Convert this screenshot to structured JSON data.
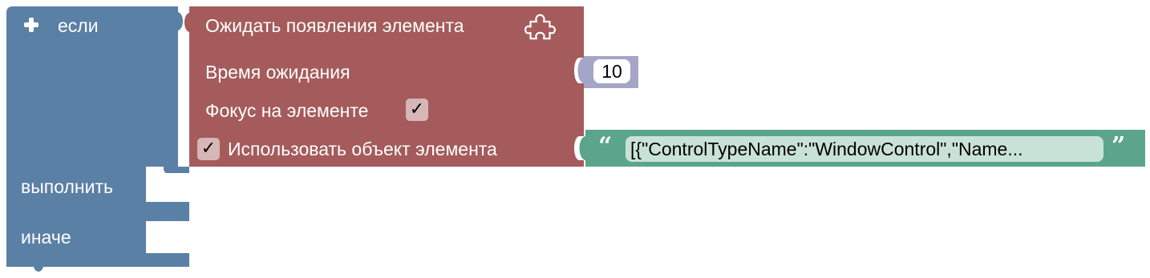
{
  "colors": {
    "if_block": "#5b80a5",
    "wait_block": "#a55b5b",
    "number_block": "#a5a5c8",
    "text_block": "#5ba58c",
    "field_bg": "#ffffff",
    "text_field_bg": "#c9e2d7",
    "checkbox_bg": "#d6b6b6",
    "text": "#ffffff"
  },
  "if_block": {
    "if_label": "если",
    "do_label": "выполнить",
    "else_label": "иначе",
    "mutator_icon": "plus-icon"
  },
  "wait_block": {
    "title": "Ожидать появления элемента",
    "icon": "puzzle-icon",
    "timeout_label": "Время ожидания",
    "focus_label": "Фокус на элементе",
    "focus_checked": true,
    "focus_checkbox_glyph": "✓",
    "use_object_label": "Использовать объект элемента",
    "use_object_checked": true,
    "use_object_checkbox_glyph": "✓"
  },
  "number_block": {
    "value": "10"
  },
  "text_block": {
    "open_quote": "“",
    "value": "[{\"ControlTypeName\":\"WindowControl\",\"Name...",
    "close_quote": "”"
  }
}
